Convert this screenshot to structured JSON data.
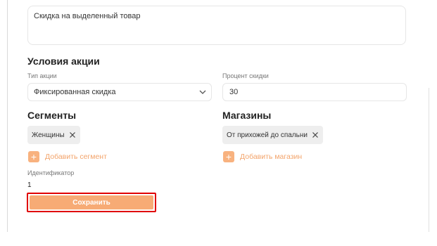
{
  "description_field": {
    "value": "Скидка на выделенный товар"
  },
  "promo_conditions": {
    "title": "Условия акции",
    "promo_type_label": "Тип акции",
    "promo_type_value": "Фиксированная скидка",
    "discount_percent_label": "Процент скидки",
    "discount_percent_value": "30"
  },
  "segments": {
    "title": "Сегменты",
    "items": [
      {
        "label": "Женщины"
      }
    ],
    "add_label": "Добавить сегмент"
  },
  "stores": {
    "title": "Магазины",
    "items": [
      {
        "label": "От прихожей до спальни"
      }
    ],
    "add_label": "Добавить магазин"
  },
  "identifier": {
    "label": "Идентификатор",
    "value": "1"
  },
  "actions": {
    "save_label": "Сохранить"
  },
  "colors": {
    "accent": "#f7ab75",
    "highlight_border": "#e00000"
  },
  "icons": {
    "dropdown": "chevron-down-icon",
    "remove": "close-icon",
    "add": "plus-icon"
  }
}
